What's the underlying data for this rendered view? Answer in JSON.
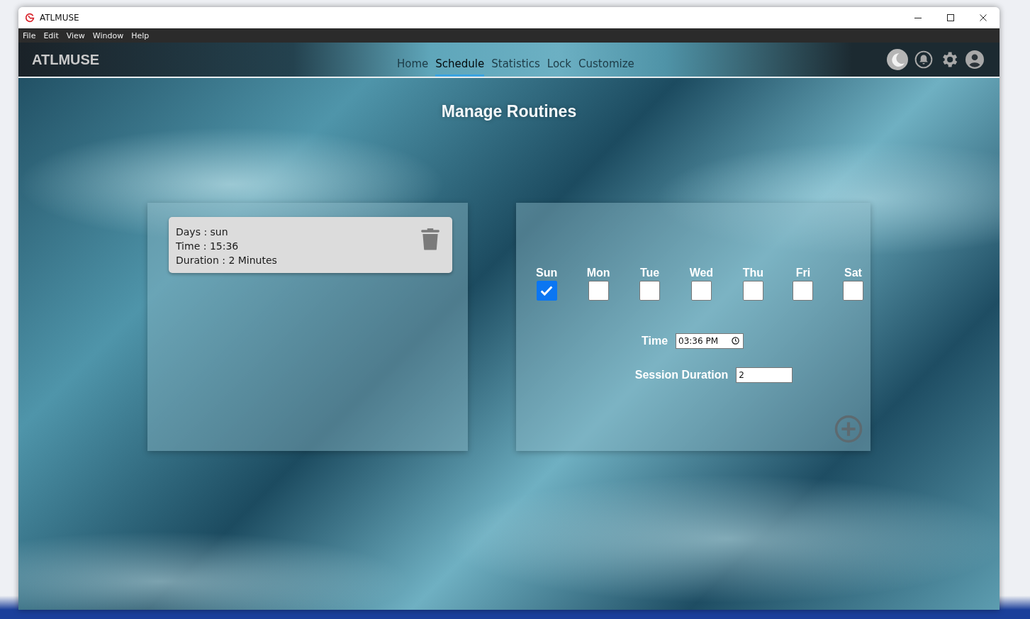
{
  "window": {
    "title": "ATLMUSE"
  },
  "menu": [
    "File",
    "Edit",
    "View",
    "Window",
    "Help"
  ],
  "navbar": {
    "brand": "ATLMUSE",
    "tabs": [
      {
        "label": "Home",
        "selected": false
      },
      {
        "label": "Schedule",
        "selected": true
      },
      {
        "label": "Statistics",
        "selected": false
      },
      {
        "label": "Lock",
        "selected": false
      },
      {
        "label": "Customize",
        "selected": false
      }
    ]
  },
  "heading": "Manage Routines",
  "routines": [
    {
      "days": "Days : sun",
      "time": "Time : 15:36",
      "duration": "Duration : 2 Minutes"
    }
  ],
  "form": {
    "days": [
      {
        "label": "Sun",
        "checked": true
      },
      {
        "label": "Mon",
        "checked": false
      },
      {
        "label": "Tue",
        "checked": false
      },
      {
        "label": "Wed",
        "checked": false
      },
      {
        "label": "Thu",
        "checked": false
      },
      {
        "label": "Fri",
        "checked": false
      },
      {
        "label": "Sat",
        "checked": false
      }
    ],
    "time_label": "Time",
    "time_value": "03:36 PM",
    "duration_label": "Session Duration",
    "duration_value": "2"
  }
}
